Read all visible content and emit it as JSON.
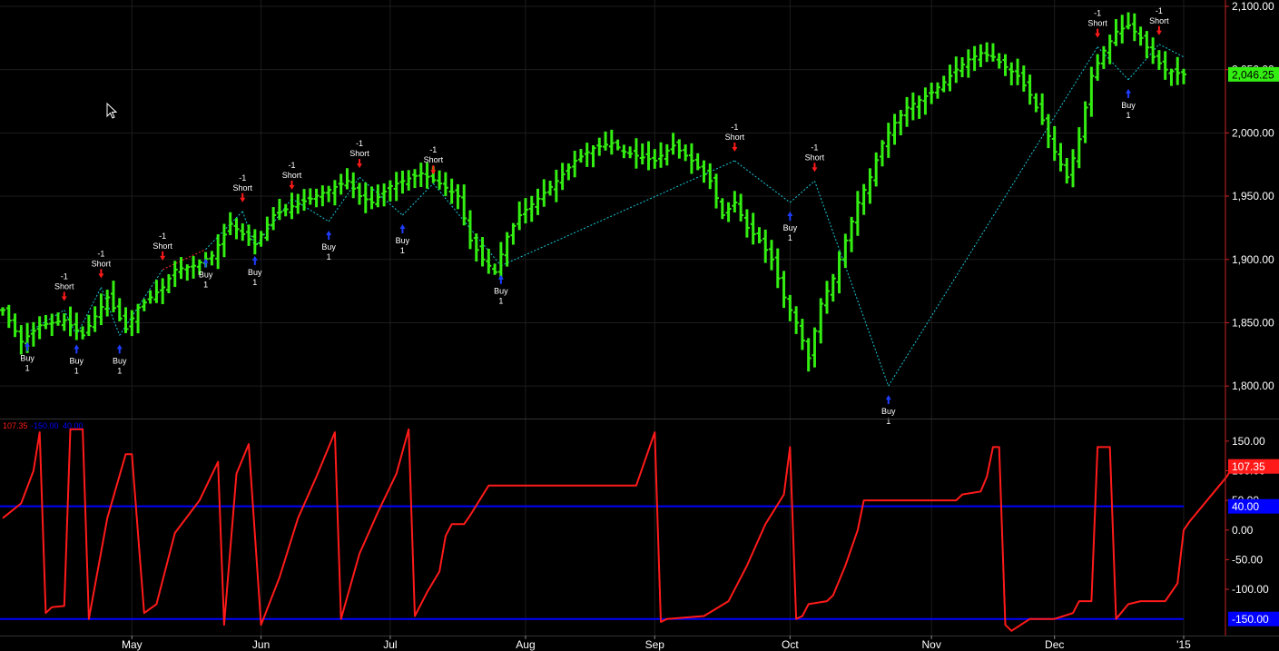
{
  "colors": {
    "background": "#000000",
    "bar_up": "#33ee11",
    "indicator_line": "#ff1a1a",
    "band_line": "#0000ff",
    "signal_buy": "#1f3dff",
    "signal_short": "#ff1a1a",
    "trade_line_win": "#18c8d8",
    "trade_line_loss": "#ff2a2a",
    "axis_text": "#ffffff",
    "axis_line": "#cc2222",
    "grid": "#1d1d1d",
    "price_badge": "#33ee11",
    "indicator_badge": "#ff1a1a",
    "band_badge": "#0000ff"
  },
  "chart_data": [
    {
      "type": "ohlc",
      "panel": "price",
      "y_ticks": [
        "1,800.00",
        "1,850.00",
        "1,900.00",
        "1,950.00",
        "2,000.00",
        "2,050.00",
        "2,100.00"
      ],
      "ylim": [
        1775,
        2105
      ],
      "last_value_label": "2,046.25",
      "last_value": 2046.25,
      "x_ticks": [
        {
          "label": "May",
          "index": 21
        },
        {
          "label": "Jun",
          "index": 42
        },
        {
          "label": "Jul",
          "index": 63
        },
        {
          "label": "Aug",
          "index": 85
        },
        {
          "label": "Sep",
          "index": 106
        },
        {
          "label": "Oct",
          "index": 128
        },
        {
          "label": "Nov",
          "index": 151
        },
        {
          "label": "Dec",
          "index": 171
        },
        {
          "label": "'15",
          "index": 192
        }
      ],
      "n_bars": 193,
      "close_anchors": [
        [
          0,
          1860
        ],
        [
          3,
          1835
        ],
        [
          6,
          1848
        ],
        [
          10,
          1852
        ],
        [
          13,
          1840
        ],
        [
          17,
          1870
        ],
        [
          20,
          1845
        ],
        [
          22,
          1862
        ],
        [
          26,
          1878
        ],
        [
          28,
          1892
        ],
        [
          31,
          1895
        ],
        [
          34,
          1903
        ],
        [
          37,
          1928
        ],
        [
          39,
          1920
        ],
        [
          41,
          1912
        ],
        [
          44,
          1935
        ],
        [
          47,
          1942
        ],
        [
          50,
          1948
        ],
        [
          53,
          1955
        ],
        [
          56,
          1962
        ],
        [
          58,
          1950
        ],
        [
          60,
          1945
        ],
        [
          63,
          1958
        ],
        [
          65,
          1962
        ],
        [
          68,
          1968
        ],
        [
          71,
          1960
        ],
        [
          74,
          1950
        ],
        [
          76,
          1915
        ],
        [
          78,
          1900
        ],
        [
          80,
          1890
        ],
        [
          82,
          1918
        ],
        [
          84,
          1935
        ],
        [
          87,
          1948
        ],
        [
          90,
          1962
        ],
        [
          93,
          1978
        ],
        [
          96,
          1988
        ],
        [
          99,
          1992
        ],
        [
          101,
          1985
        ],
        [
          103,
          1982
        ],
        [
          106,
          1978
        ],
        [
          109,
          1990
        ],
        [
          112,
          1978
        ],
        [
          115,
          1962
        ],
        [
          117,
          1935
        ],
        [
          119,
          1945
        ],
        [
          121,
          1925
        ],
        [
          123,
          1915
        ],
        [
          125,
          1900
        ],
        [
          127,
          1870
        ],
        [
          129,
          1850
        ],
        [
          131,
          1822
        ],
        [
          133,
          1865
        ],
        [
          135,
          1885
        ],
        [
          137,
          1915
        ],
        [
          139,
          1945
        ],
        [
          141,
          1965
        ],
        [
          143,
          1992
        ],
        [
          145,
          2008
        ],
        [
          147,
          2020
        ],
        [
          149,
          2026
        ],
        [
          151,
          2032
        ],
        [
          153,
          2040
        ],
        [
          155,
          2050
        ],
        [
          157,
          2058
        ],
        [
          159,
          2063
        ],
        [
          161,
          2060
        ],
        [
          163,
          2052
        ],
        [
          165,
          2045
        ],
        [
          167,
          2030
        ],
        [
          169,
          2010
        ],
        [
          171,
          1985
        ],
        [
          173,
          1965
        ],
        [
          175,
          1995
        ],
        [
          177,
          2045
        ],
        [
          179,
          2065
        ],
        [
          181,
          2080
        ],
        [
          183,
          2085
        ],
        [
          185,
          2075
        ],
        [
          187,
          2060
        ],
        [
          189,
          2050
        ],
        [
          192,
          2046
        ]
      ],
      "signals": [
        {
          "type": "Buy",
          "qty": "1",
          "index": 4,
          "price": 1842
        },
        {
          "type": "Short",
          "qty": "-1",
          "index": 10,
          "price": 1860
        },
        {
          "type": "Buy",
          "qty": "1",
          "index": 12,
          "price": 1840
        },
        {
          "type": "Short",
          "qty": "-1",
          "index": 16,
          "price": 1878
        },
        {
          "type": "Buy",
          "qty": "1",
          "index": 19,
          "price": 1840
        },
        {
          "type": "Short",
          "qty": "-1",
          "index": 26,
          "price": 1892
        },
        {
          "type": "Buy",
          "qty": "1",
          "index": 33,
          "price": 1908
        },
        {
          "type": "Short",
          "qty": "-1",
          "index": 39,
          "price": 1938
        },
        {
          "type": "Buy",
          "qty": "1",
          "index": 41,
          "price": 1910
        },
        {
          "type": "Short",
          "qty": "-1",
          "index": 47,
          "price": 1948
        },
        {
          "type": "Buy",
          "qty": "1",
          "index": 53,
          "price": 1930
        },
        {
          "type": "Short",
          "qty": "-1",
          "index": 58,
          "price": 1965
        },
        {
          "type": "Buy",
          "qty": "1",
          "index": 65,
          "price": 1935
        },
        {
          "type": "Short",
          "qty": "-1",
          "index": 70,
          "price": 1960
        },
        {
          "type": "Buy",
          "qty": "1",
          "index": 81,
          "price": 1895
        },
        {
          "type": "Short",
          "qty": "-1",
          "index": 119,
          "price": 1978
        },
        {
          "type": "Buy",
          "qty": "1",
          "index": 128,
          "price": 1945
        },
        {
          "type": "Short",
          "qty": "-1",
          "index": 132,
          "price": 1962
        },
        {
          "type": "Buy",
          "qty": "1",
          "index": 144,
          "price": 1800
        },
        {
          "type": "Short",
          "qty": "-1",
          "index": 178,
          "price": 2068
        },
        {
          "type": "Buy",
          "qty": "1",
          "index": 183,
          "price": 2042
        },
        {
          "type": "Short",
          "qty": "-1",
          "index": 188,
          "price": 2070
        },
        {
          "type": "Buy",
          "qty": "1",
          "index": 205,
          "price": 2060
        }
      ]
    },
    {
      "type": "line",
      "panel": "indicator",
      "header_values": [
        {
          "label": "107.35",
          "color": "#ff1a1a"
        },
        {
          "label": "-150.00",
          "color": "#0000ff"
        },
        {
          "label": "40.00",
          "color": "#0000ff"
        }
      ],
      "y_ticks": [
        "-100.00",
        "-50.00",
        "0.00",
        "50.00",
        "100.00",
        "150.00"
      ],
      "ylim": [
        -178,
        185
      ],
      "bands": [
        {
          "value": 40,
          "label": "40.00"
        },
        {
          "value": -150,
          "label": "-150.00"
        }
      ],
      "last_value_label": "107.35",
      "last_value": 107.35,
      "values_anchors": [
        [
          0,
          20
        ],
        [
          3,
          45
        ],
        [
          5,
          100
        ],
        [
          6,
          165
        ],
        [
          7,
          -140
        ],
        [
          8,
          -130
        ],
        [
          10,
          -128
        ],
        [
          11,
          170
        ],
        [
          13,
          170
        ],
        [
          14,
          -150
        ],
        [
          17,
          20
        ],
        [
          20,
          128
        ],
        [
          21,
          128
        ],
        [
          23,
          -140
        ],
        [
          25,
          -125
        ],
        [
          28,
          -5
        ],
        [
          32,
          50
        ],
        [
          35,
          115
        ],
        [
          36,
          -160
        ],
        [
          38,
          95
        ],
        [
          40,
          145
        ],
        [
          42,
          -160
        ],
        [
          45,
          -80
        ],
        [
          48,
          20
        ],
        [
          51,
          90
        ],
        [
          54,
          165
        ],
        [
          55,
          -150
        ],
        [
          58,
          -40
        ],
        [
          61,
          30
        ],
        [
          64,
          95
        ],
        [
          66,
          170
        ],
        [
          67,
          -145
        ],
        [
          69,
          -105
        ],
        [
          71,
          -70
        ],
        [
          72,
          -10
        ],
        [
          73,
          10
        ],
        [
          75,
          10
        ],
        [
          76,
          25
        ],
        [
          79,
          75
        ],
        [
          85,
          75
        ],
        [
          103,
          75
        ],
        [
          106,
          165
        ],
        [
          107,
          -155
        ],
        [
          108,
          -150
        ],
        [
          114,
          -145
        ],
        [
          118,
          -120
        ],
        [
          121,
          -60
        ],
        [
          124,
          10
        ],
        [
          127,
          60
        ],
        [
          128,
          140
        ],
        [
          129,
          -150
        ],
        [
          130,
          -145
        ],
        [
          131,
          -125
        ],
        [
          134,
          -120
        ],
        [
          135,
          -110
        ],
        [
          137,
          -60
        ],
        [
          139,
          0
        ],
        [
          140,
          50
        ],
        [
          144,
          50
        ],
        [
          155,
          50
        ],
        [
          156,
          60
        ],
        [
          159,
          65
        ],
        [
          160,
          90
        ],
        [
          161,
          140
        ],
        [
          162,
          140
        ],
        [
          163,
          -160
        ],
        [
          164,
          -170
        ],
        [
          167,
          -150
        ],
        [
          171,
          -150
        ],
        [
          174,
          -140
        ],
        [
          175,
          -120
        ],
        [
          177,
          -120
        ],
        [
          178,
          140
        ],
        [
          180,
          140
        ],
        [
          181,
          -150
        ],
        [
          183,
          -125
        ],
        [
          185,
          -120
        ],
        [
          189,
          -120
        ],
        [
          191,
          -90
        ],
        [
          192,
          0
        ],
        [
          193,
          15
        ],
        [
          197,
          65
        ],
        [
          199,
          90
        ],
        [
          200,
          107
        ]
      ]
    }
  ]
}
